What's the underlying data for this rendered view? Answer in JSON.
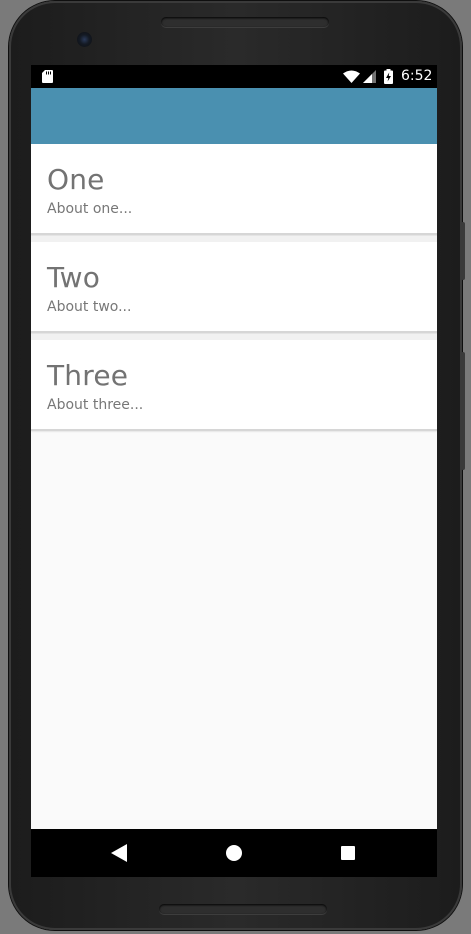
{
  "status_bar": {
    "time": "6:52",
    "icons": [
      "sd-card-icon",
      "wifi-icon",
      "cell-signal-icon",
      "battery-charging-icon"
    ]
  },
  "app_bar": {
    "color": "#4a90b0",
    "title": ""
  },
  "list": {
    "items": [
      {
        "title": "One",
        "subtitle": "About one..."
      },
      {
        "title": "Two",
        "subtitle": "About two..."
      },
      {
        "title": "Three",
        "subtitle": "About three..."
      }
    ]
  },
  "nav_bar": {
    "icons": [
      "back-icon",
      "home-icon",
      "recents-icon"
    ]
  },
  "colors": {
    "accent": "#4a90b0",
    "background": "#fafafa",
    "card": "#ffffff",
    "title_text": "#737373",
    "subtitle_text": "#777777"
  }
}
